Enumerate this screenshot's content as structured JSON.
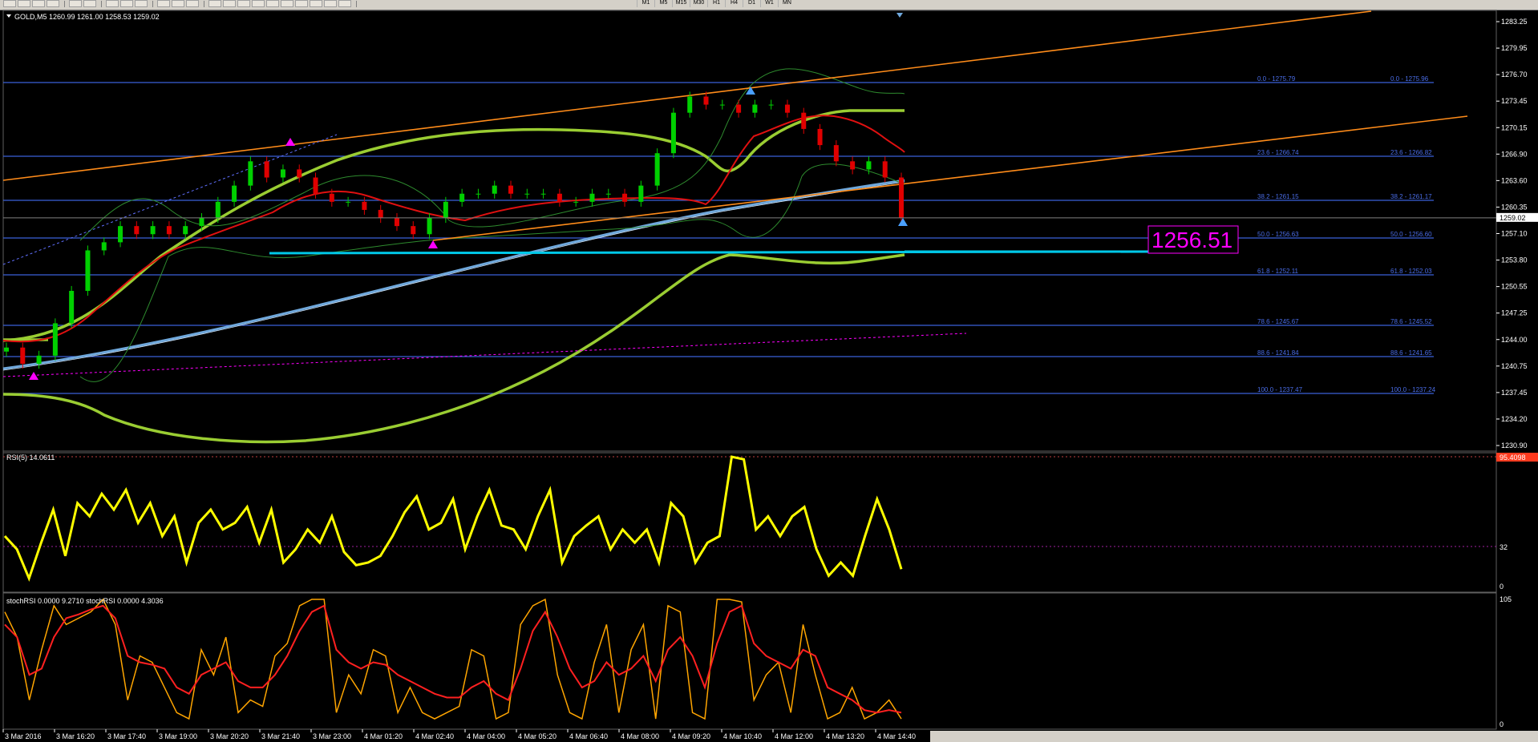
{
  "toolbar": {
    "timeframes": [
      "M1",
      "M5",
      "M15",
      "M30",
      "H1",
      "H4",
      "D1",
      "W1",
      "MN"
    ]
  },
  "main": {
    "symbol_info": "GOLD,M5  1260.99 1261.00 1258.53 1259.02",
    "current_price_label": "1259.02",
    "price_ticks": [
      "1283.25",
      "1279.95",
      "1276.70",
      "1273.45",
      "1270.15",
      "1266.90",
      "1263.60",
      "1260.35",
      "1257.10",
      "1253.80",
      "1250.55",
      "1247.25",
      "1244.00",
      "1240.75",
      "1237.45",
      "1234.20",
      "1230.90"
    ],
    "fib_levels": [
      {
        "left": "0.0 - 1275.79",
        "right": "0.0 - 1275.96"
      },
      {
        "left": "23.6 - 1266.74",
        "right": "23.6 - 1266.82"
      },
      {
        "left": "38.2 - 1261.15",
        "right": "38.2 - 1261.17"
      },
      {
        "left": "50.0 - 1256.63",
        "right": "50.0 - 1256.60"
      },
      {
        "left": "61.8 - 1252.11",
        "right": "61.8 - 1252.03"
      },
      {
        "left": "78.6 - 1245.67",
        "right": "78.6 - 1245.52"
      },
      {
        "left": "88.6 - 1241.84",
        "right": "88.6 - 1241.65"
      },
      {
        "left": "100.0 - 1237.47",
        "right": "100.0 - 1237.24"
      }
    ],
    "big_price_label": "1256.51"
  },
  "rsi": {
    "title": "RSI(5) 14.0611",
    "level_label": "95.4098",
    "tick_mid": "32",
    "tick_low": "0"
  },
  "stoch": {
    "title": "stochRSI 0.0000 9.2710  stochRSI 0.0000 4.3036",
    "tick_high": "105",
    "tick_low": "0"
  },
  "time_axis": [
    "3 Mar 2016",
    "3 Mar 16:20",
    "3 Mar 17:40",
    "3 Mar 19:00",
    "3 Mar 20:20",
    "3 Mar 21:40",
    "3 Mar 23:00",
    "4 Mar 01:20",
    "4 Mar 02:40",
    "4 Mar 04:00",
    "4 Mar 05:20",
    "4 Mar 06:40",
    "4 Mar 08:00",
    "4 Mar 09:20",
    "4 Mar 10:40",
    "4 Mar 12:00",
    "4 Mar 13:20",
    "4 Mar 14:40"
  ],
  "colors": {
    "background": "#000000",
    "fib_line": "#3a5fd8",
    "fib_text": "#4a6de8",
    "channel": "#ff8c1a",
    "ma_red": "#e01010",
    "ma_lime": "#9acd32",
    "ma_blue": "#6fa8dc",
    "bollinger": "#2e8b2e",
    "support_cyan": "#00c8e8",
    "magenta": "#ff00ff",
    "rsi_line": "#ffff00",
    "stoch_orange": "#ffa500",
    "stoch_red": "#ff2020",
    "candle_up": "#00d000",
    "candle_down": "#e00000"
  },
  "chart_data": {
    "type": "line",
    "symbol": "GOLD",
    "timeframe": "M5",
    "ylim": [
      1230.9,
      1283.25
    ],
    "close_series": [
      1243,
      1241,
      1242,
      1246,
      1250,
      1255,
      1256,
      1258,
      1257,
      1258,
      1257,
      1258,
      1259,
      1261,
      1263,
      1266,
      1264,
      1265,
      1264,
      1262,
      1261,
      1261,
      1260,
      1259,
      1258,
      1257,
      1259,
      1261,
      1262,
      1262,
      1263,
      1262,
      1262,
      1262,
      1261,
      1261,
      1262,
      1262,
      1261,
      1263,
      1267,
      1272,
      1274,
      1273,
      1273,
      1272,
      1273,
      1273,
      1272,
      1270,
      1268,
      1266,
      1265,
      1266,
      1264,
      1259.02
    ],
    "fib_levels_pct": [
      0,
      23.6,
      38.2,
      50,
      61.8,
      78.6,
      88.6,
      100
    ]
  }
}
